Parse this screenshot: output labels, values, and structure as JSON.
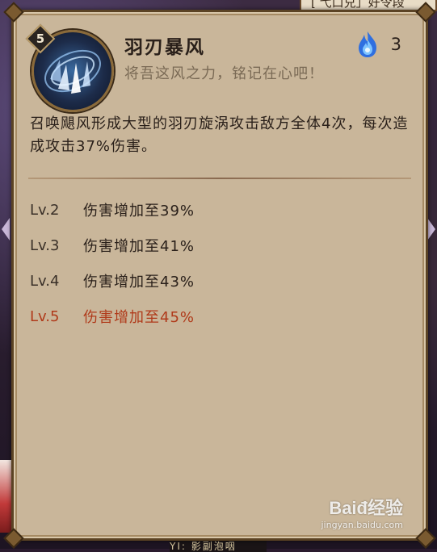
{
  "background": {
    "top_banner": "[ 弋口兑」好令段",
    "bottom_peek": "YI: 影副泡咽"
  },
  "skill": {
    "level": "5",
    "name": "羽刃暴风",
    "quote": "将吾这风之力，铭记在心吧！",
    "cost_icon": "blue-flame-icon",
    "cost": "3",
    "description": "召唤飓风形成大型的羽刃旋涡攻击敌方全体4次，每次造成攻击37%伤害。"
  },
  "levels": [
    {
      "label": "Lv.2",
      "text": "伤害增加至39%",
      "current": false
    },
    {
      "label": "Lv.3",
      "text": "伤害增加至41%",
      "current": false
    },
    {
      "label": "Lv.4",
      "text": "伤害增加至43%",
      "current": false
    },
    {
      "label": "Lv.5",
      "text": "伤害增加至45%",
      "current": true
    }
  ],
  "colors": {
    "panel_bg": "#c9b69a",
    "current_level": "#b03a1a",
    "text": "#2a201a"
  },
  "watermark": {
    "logo": "Baiđ经验",
    "site": "jingyan.baidu.com"
  }
}
